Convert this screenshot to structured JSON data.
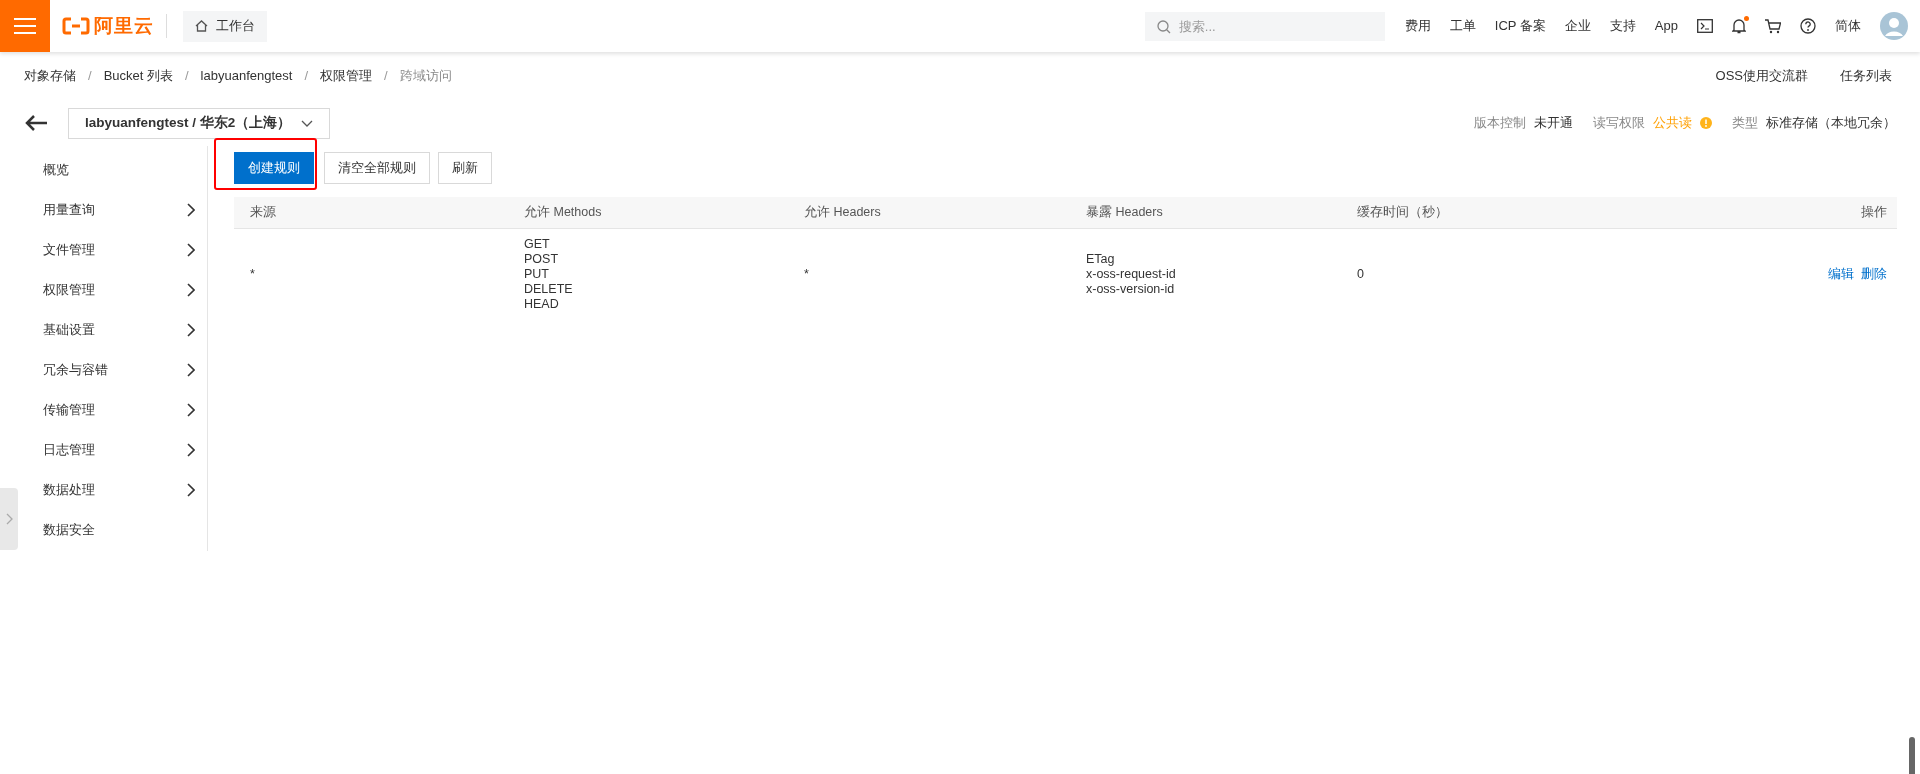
{
  "topbar": {
    "logo": "阿里云",
    "workbench": "工作台",
    "search": {
      "placeholder": "搜索..."
    },
    "links": [
      "费用",
      "工单",
      "ICP 备案",
      "企业",
      "支持",
      "App"
    ],
    "notification_dot": true,
    "language": "简体"
  },
  "breadcrumb": [
    {
      "text": "对象存储",
      "kind": "link"
    },
    {
      "text": "/",
      "kind": "separator"
    },
    {
      "text": "Bucket 列表",
      "kind": "link"
    },
    {
      "text": "/",
      "kind": "separator"
    },
    {
      "text": "labyuanfengtest",
      "kind": "link"
    },
    {
      "text": "/",
      "kind": "separator"
    },
    {
      "text": "权限管理",
      "kind": "link"
    },
    {
      "text": "/",
      "kind": "separator"
    },
    {
      "text": "跨域访问",
      "kind": "current"
    }
  ],
  "header_links": [
    "OSS使用交流群",
    "任务列表"
  ],
  "bucket_selector": "labyuanfengtest / 华东2（上海）",
  "bucket_info": [
    {
      "label": "版本控制",
      "value": "未开通",
      "kind": "plain"
    },
    {
      "label": "读写权限",
      "value": "公共读",
      "kind": "warning"
    },
    {
      "label": "类型",
      "value": "标准存储（本地冗余）",
      "kind": "plain"
    }
  ],
  "sidebar": {
    "items": [
      {
        "label": "概览",
        "expandable": false
      },
      {
        "label": "用量查询",
        "expandable": true
      },
      {
        "label": "文件管理",
        "expandable": true
      },
      {
        "label": "权限管理",
        "expandable": true
      },
      {
        "label": "基础设置",
        "expandable": true
      },
      {
        "label": "冗余与容错",
        "expandable": true
      },
      {
        "label": "传输管理",
        "expandable": true
      },
      {
        "label": "日志管理",
        "expandable": true
      },
      {
        "label": "数据处理",
        "expandable": true
      },
      {
        "label": "数据安全",
        "expandable": false
      }
    ]
  },
  "toolbar": [
    {
      "label": "创建规则",
      "kind": "primary",
      "highlighted": true
    },
    {
      "label": "清空全部规则",
      "kind": "default",
      "highlighted": false
    },
    {
      "label": "刷新",
      "kind": "default",
      "highlighted": false
    }
  ],
  "table": {
    "columns": [
      "来源",
      "允许 Methods",
      "允许 Headers",
      "暴露 Headers",
      "缓存时间（秒）",
      "操作"
    ],
    "rows": [
      {
        "source": "*",
        "methods": [
          "GET",
          "POST",
          "PUT",
          "DELETE",
          "HEAD"
        ],
        "allow_headers": "*",
        "expose_headers": [
          "ETag",
          "x-oss-request-id",
          "x-oss-version-id"
        ],
        "max_age": "0",
        "actions": [
          "编辑",
          "删除"
        ]
      }
    ]
  }
}
